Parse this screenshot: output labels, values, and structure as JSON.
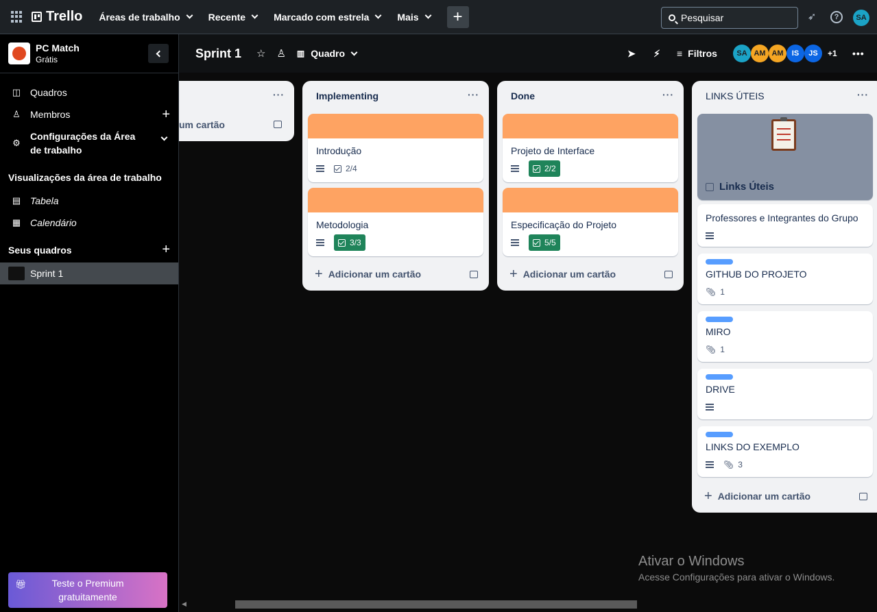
{
  "topbar": {
    "brand": "Trello",
    "nav": [
      "Áreas de trabalho",
      "Recente",
      "Marcado com estrela",
      "Mais"
    ],
    "create_label": "+",
    "search_placeholder": "Pesquisar",
    "user_initials": "SA"
  },
  "sidebar": {
    "workspace_name": "PC Match",
    "plan": "Grátis",
    "links": [
      {
        "label": "Quadros",
        "icon": "board-icon"
      },
      {
        "label": "Membros",
        "icon": "person-icon"
      },
      {
        "label": "Configurações da Área de trabalho",
        "icon": "gear-icon"
      }
    ],
    "views_heading": "Visualizações da área de trabalho",
    "views": [
      {
        "label": "Tabela",
        "icon": "table-icon"
      },
      {
        "label": "Calendário",
        "icon": "calendar-icon"
      }
    ],
    "boards_heading": "Seus quadros",
    "boards": [
      "Sprint 1"
    ],
    "premium_label": "Teste o Premium gratuitamente"
  },
  "board": {
    "title": "Sprint 1",
    "view_label": "Quadro",
    "filters_label": "Filtros",
    "members": [
      {
        "initials": "SA",
        "color": "#1ba3c6"
      },
      {
        "initials": "AM",
        "color": "#f5a623"
      },
      {
        "initials": "AM",
        "color": "#f5a623"
      },
      {
        "initials": "IS",
        "color": "#0c66e4"
      },
      {
        "initials": "JS",
        "color": "#0c66e4"
      }
    ],
    "extra_members": "+1"
  },
  "lists": [
    {
      "name": "",
      "add_label": "Adicionar um cartão"
    },
    {
      "name": "Implementing",
      "cards": [
        {
          "title": "Introdução",
          "checklist": "2/4",
          "complete": false
        },
        {
          "title": "Metodologia",
          "checklist": "3/3",
          "complete": true
        }
      ],
      "add_label": "Adicionar um cartão"
    },
    {
      "name": "Done",
      "cards": [
        {
          "title": "Projeto de Interface",
          "checklist": "2/2",
          "complete": true
        },
        {
          "title": "Especificação do Projeto",
          "checklist": "5/5",
          "complete": true
        }
      ],
      "add_label": "Adicionar um cartão"
    },
    {
      "name": "LINKS ÚTEIS",
      "cover_card_title": "Links Úteis",
      "cards": [
        {
          "title": "Professores e Integrantes do Grupo"
        },
        {
          "title": "GITHUB DO PROJETO",
          "attachments": "1"
        },
        {
          "title": "MIRO",
          "attachments": "1"
        },
        {
          "title": "DRIVE"
        },
        {
          "title": "LINKS DO EXEMPLO",
          "attachments": "3"
        }
      ],
      "add_label": "Adicionar um cartão"
    }
  ],
  "watermark": {
    "title": "Ativar o Windows",
    "subtitle": "Acesse Configurações para ativar o Windows."
  },
  "colors": {
    "cover_orange": "#fea362",
    "label_blue": "#579dff",
    "checklist_complete": "#1f845a"
  }
}
